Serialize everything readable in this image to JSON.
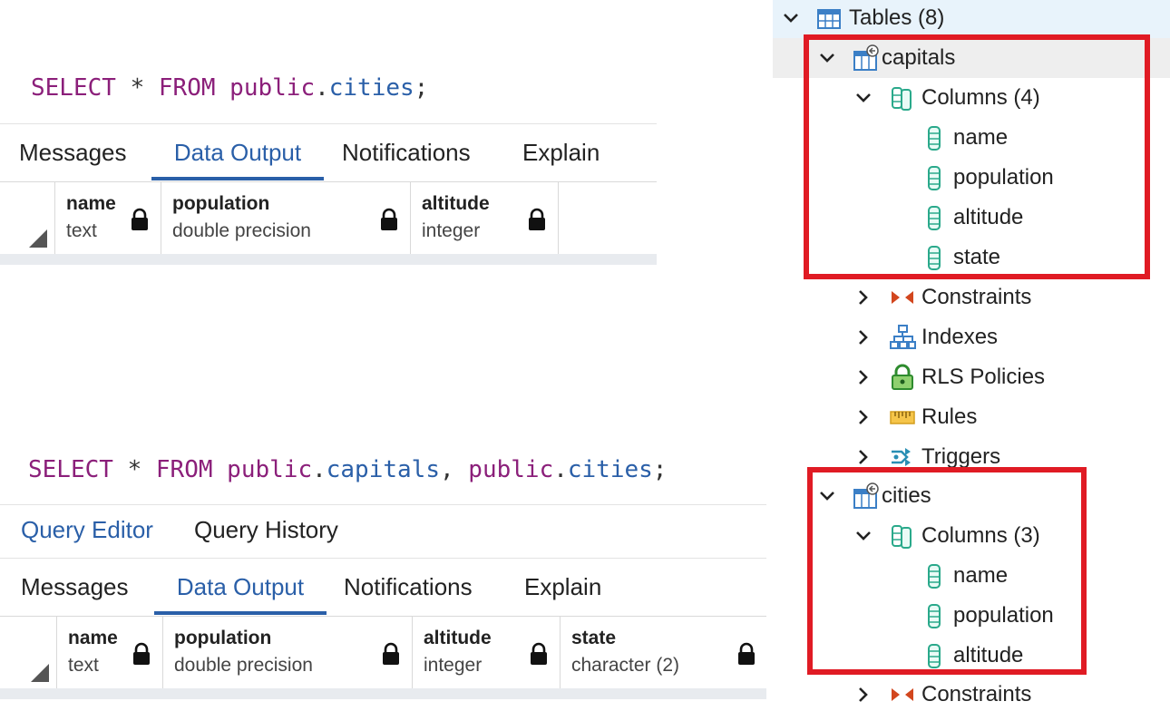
{
  "query1": {
    "keyword1": "SELECT",
    "star": "*",
    "keyword2": "FROM",
    "schema": "public",
    "dot": ".",
    "table": "cities",
    "semi": ";"
  },
  "query2": {
    "keyword1": "SELECT",
    "star": "*",
    "keyword2": "FROM",
    "schema1": "public",
    "table1": "capitals",
    "comma": ",",
    "schema2": "public",
    "table2": "cities",
    "dot": ".",
    "semi": ";"
  },
  "editor_tabs": [
    "Query Editor",
    "Query History"
  ],
  "result_tabs": [
    "Messages",
    "Data Output",
    "Notifications",
    "Explain"
  ],
  "grid1": {
    "columns": [
      {
        "name": "name",
        "type": "text"
      },
      {
        "name": "population",
        "type": "double precision"
      },
      {
        "name": "altitude",
        "type": "integer"
      }
    ]
  },
  "grid2": {
    "columns": [
      {
        "name": "name",
        "type": "text"
      },
      {
        "name": "population",
        "type": "double precision"
      },
      {
        "name": "altitude",
        "type": "integer"
      },
      {
        "name": "state",
        "type": "character (2)"
      }
    ]
  },
  "tree": {
    "tables": "Tables (8)",
    "capitals": {
      "label": "capitals",
      "columns_label": "Columns (4)",
      "columns": [
        "name",
        "population",
        "altitude",
        "state"
      ],
      "constraints": "Constraints",
      "indexes": "Indexes",
      "rls": "RLS Policies",
      "rules": "Rules",
      "triggers": "Triggers"
    },
    "cities": {
      "label": "cities",
      "columns_label": "Columns (3)",
      "columns": [
        "name",
        "population",
        "altitude"
      ],
      "constraints": "Constraints"
    }
  },
  "colors": {
    "accent": "#2a5fa8",
    "keyword": "#8b1f7a",
    "highlight_box": "#e01b24",
    "selected_row": "#e8f3fb",
    "hover_row": "#eeeeee"
  },
  "icons": [
    "chevron-down-icon",
    "chevron-right-icon",
    "table-icon",
    "columns-icon",
    "column-icon",
    "constraints-icon",
    "indexes-icon",
    "rls-policy-icon",
    "rules-icon",
    "triggers-icon",
    "lock-icon"
  ]
}
